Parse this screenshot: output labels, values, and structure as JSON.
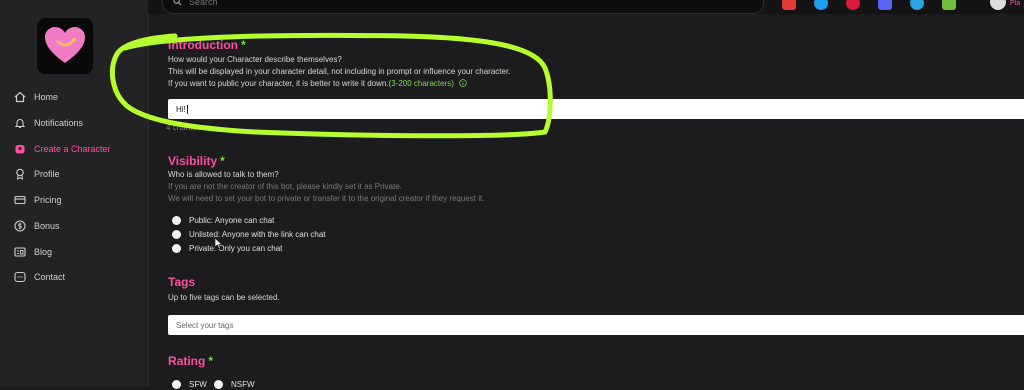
{
  "search": {
    "placeholder": "Search"
  },
  "sidebar": {
    "items": [
      {
        "label": "Home",
        "icon": "home-icon"
      },
      {
        "label": "Notifications",
        "icon": "bell-icon"
      },
      {
        "label": "Create a Character",
        "icon": "character-icon",
        "active": true
      },
      {
        "label": "Profile",
        "icon": "award-icon"
      },
      {
        "label": "Pricing",
        "icon": "card-icon"
      },
      {
        "label": "Bonus",
        "icon": "dollar-icon"
      },
      {
        "label": "Blog",
        "icon": "blog-icon"
      },
      {
        "label": "Contact",
        "icon": "chat-icon"
      }
    ]
  },
  "header": {
    "user_label": "Pla"
  },
  "introduction": {
    "title": "Introduction",
    "required_mark": "*",
    "question": "How would your Character describe themselves?",
    "note": "This will be displayed in your character detail, not including in prompt or influence your character.",
    "tip": "If you want to public your character, it is better to write it down.",
    "limit": "(3-200 characters)",
    "value": "Hi!",
    "count": "4 characters"
  },
  "visibility": {
    "title": "Visibility",
    "required_mark": "*",
    "question": "Who is allowed to talk to them?",
    "note1": "If you are not the creator of this bot, please kindly set it as Private.",
    "note2": "We will need to set your bot to private or transfer it to the original creator if they request it.",
    "options": [
      "Public: Anyone can chat",
      "Unlisted: Anyone with the link can chat",
      "Private: Only you can chat"
    ]
  },
  "tags": {
    "title": "Tags",
    "note": "Up to five tags can be selected.",
    "placeholder": "Select your tags"
  },
  "rating": {
    "title": "Rating",
    "required_mark": "*",
    "options": [
      "SFW",
      "NSFW"
    ]
  },
  "colors": {
    "accent": "#ff4fa3",
    "required": "#7dd94a",
    "annotation": "#b6ff2e"
  }
}
